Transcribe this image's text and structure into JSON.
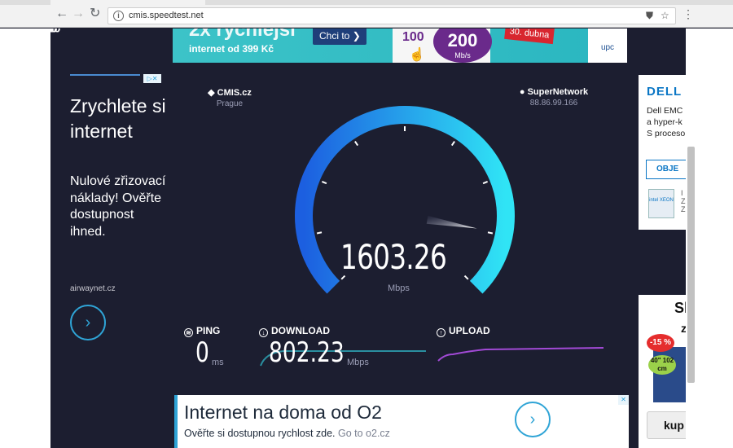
{
  "browser": {
    "url": "cmis.speedtest.net",
    "back_icon": "←",
    "forward_icon": "→",
    "reload_icon": "↻"
  },
  "top_banner": {
    "headline": "2x rychlejší",
    "subline": "internet od 399 Kč",
    "button": "Chci to",
    "speed_old": "100",
    "speed_new": "200",
    "speed_unit": "Mb/s",
    "date": "30. dubna",
    "brand": "upc"
  },
  "left_ad": {
    "headline": "Zrychlete si internet",
    "body": "Nulové zřizovací náklady! Ověřte dostupnost ihned.",
    "source": "airwaynet.cz",
    "go_icon": "›"
  },
  "host": {
    "name": "CMIS.cz",
    "location": "Prague"
  },
  "isp": {
    "name": "SuperNetwork",
    "ip": "88.86.99.166"
  },
  "gauge": {
    "value": "1603.26",
    "unit": "Mbps",
    "ticks": [
      "0",
      "1",
      "5",
      "10",
      "20",
      "30",
      "50",
      "75",
      "100"
    ],
    "needle_fraction": 0.87,
    "accent_start": "#1c5fe0",
    "accent_end": "#30e4f5"
  },
  "metrics": {
    "ping_label": "PING",
    "ping_value": "0",
    "ping_unit": "ms",
    "download_label": "DOWNLOAD",
    "download_value": "802.23",
    "download_unit": "Mbps",
    "upload_label": "UPLOAD"
  },
  "bottom_ad": {
    "headline": "Internet na doma od O2",
    "body": "Ověřte si dostupnou rychlost zde.",
    "link": "Go to o2.cz",
    "go_icon": "›"
  },
  "right_ad_top": {
    "logo": "DELL",
    "line1": "Dell EMC",
    "line2": "a hyper-k",
    "line3": "S proceso",
    "button": "OBJE",
    "chip": "intel XEON"
  },
  "right_ad_bottom": {
    "title": "Sl",
    "subtitle": "z",
    "discount": "-15 %",
    "tv_size": "40\" 102 cm",
    "buy": "kup"
  }
}
